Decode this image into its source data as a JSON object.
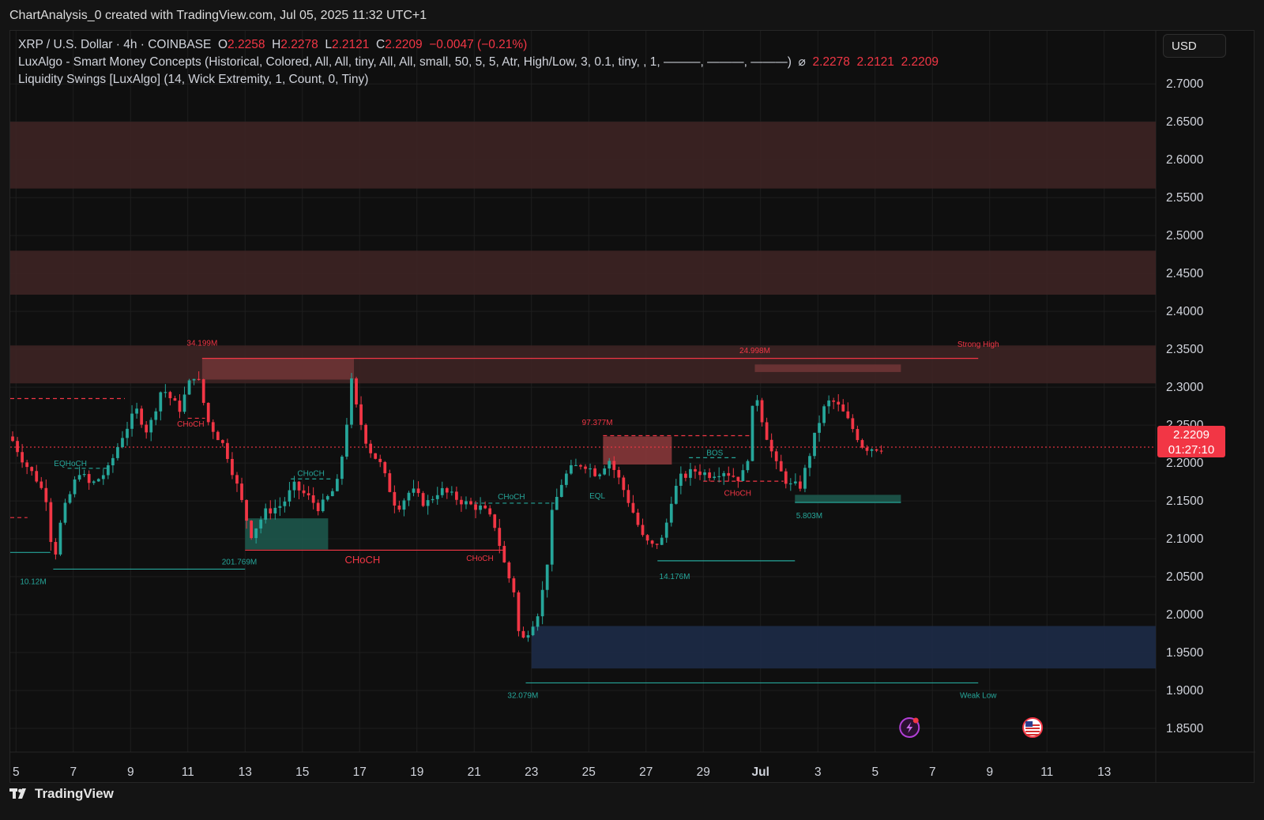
{
  "header": {
    "credit": "ChartAnalysis_0 created with TradingView.com, Jul 05, 2025 11:32 UTC+1"
  },
  "legend": {
    "line1": {
      "symbol": "XRP / U.S. Dollar · 4h · COINBASE",
      "o_label": "O",
      "o_value": "2.2258",
      "h_label": "H",
      "h_value": "2.2278",
      "l_label": "L",
      "l_value": "2.2121",
      "c_label": "C",
      "c_value": "2.2209",
      "change": "−0.0047 (−0.21%)"
    },
    "line2": {
      "text": "LuxAlgo - Smart Money Concepts (Historical, Colored, All, All, tiny, All, All, small, 50, 5, 5, Atr, High/Low, 3, 0.1, tiny, , 1, ———, ———, ———)",
      "symbol": "⌀",
      "v1": "2.2278",
      "v2": "2.2121",
      "v3": "2.2209"
    },
    "line3": {
      "text": "Liquidity Swings [LuxAlgo] (14, Wick Extremity, 1, Count, 0, Tiny)"
    }
  },
  "currency": "USD",
  "last_price": {
    "value": "2.2209",
    "countdown": "01:27:10"
  },
  "brand": {
    "name": "TradingView"
  },
  "colors": {
    "up": "#26a69a",
    "down": "#f23645",
    "background": "#0f0f0f",
    "supply_zone": "#3d2324",
    "demand_zone": "#1c2a45",
    "grid": "#1e1e1e"
  },
  "icons": [
    "lightning-event-icon",
    "us-flag-icon"
  ],
  "chart_data": {
    "type": "candlestick",
    "timeframe": "4h",
    "ylim": [
      1.825,
      2.72
    ],
    "y_ticks": [
      2.7,
      2.65,
      2.6,
      2.55,
      2.5,
      2.45,
      2.4,
      2.35,
      2.3,
      2.25,
      2.2,
      2.15,
      2.1,
      2.05,
      2.0,
      1.95,
      1.9,
      1.85
    ],
    "y_tick_labels": [
      "2.7000",
      "2.6500",
      "2.6000",
      "2.5500",
      "2.5000",
      "2.4500",
      "2.4000",
      "2.3500",
      "2.3000",
      "2.2500",
      "2.2000",
      "2.1500",
      "2.1000",
      "2.0500",
      "2.0000",
      "1.9500",
      "1.9000",
      "1.8500"
    ],
    "x_day_range": [
      4.8,
      44.8
    ],
    "x_ticks": [
      {
        "day": 5,
        "label": "5"
      },
      {
        "day": 7,
        "label": "7"
      },
      {
        "day": 9,
        "label": "9"
      },
      {
        "day": 11,
        "label": "11"
      },
      {
        "day": 13,
        "label": "13"
      },
      {
        "day": 15,
        "label": "15"
      },
      {
        "day": 17,
        "label": "17"
      },
      {
        "day": 19,
        "label": "19"
      },
      {
        "day": 21,
        "label": "21"
      },
      {
        "day": 23,
        "label": "23"
      },
      {
        "day": 25,
        "label": "25"
      },
      {
        "day": 27,
        "label": "27"
      },
      {
        "day": 29,
        "label": "29"
      },
      {
        "day": 31,
        "label": "Jul"
      },
      {
        "day": 33,
        "label": "3"
      },
      {
        "day": 35,
        "label": "5"
      },
      {
        "day": 37,
        "label": "7"
      },
      {
        "day": 39,
        "label": "9"
      },
      {
        "day": 41,
        "label": "11"
      },
      {
        "day": 43,
        "label": "13"
      }
    ],
    "anchors": [
      [
        4.8,
        2.235
      ],
      [
        5.3,
        2.2
      ],
      [
        5.7,
        2.18
      ],
      [
        6.1,
        2.15
      ],
      [
        6.3,
        2.065
      ],
      [
        6.6,
        2.13
      ],
      [
        7.2,
        2.19
      ],
      [
        7.6,
        2.17
      ],
      [
        8.2,
        2.19
      ],
      [
        8.7,
        2.235
      ],
      [
        9.2,
        2.27
      ],
      [
        9.6,
        2.24
      ],
      [
        10.1,
        2.3
      ],
      [
        10.7,
        2.27
      ],
      [
        11.1,
        2.31
      ],
      [
        11.3,
        2.32
      ],
      [
        11.7,
        2.255
      ],
      [
        12.3,
        2.22
      ],
      [
        12.8,
        2.16
      ],
      [
        13.2,
        2.105
      ],
      [
        13.7,
        2.135
      ],
      [
        14.3,
        2.145
      ],
      [
        14.7,
        2.17
      ],
      [
        15.2,
        2.155
      ],
      [
        15.6,
        2.14
      ],
      [
        16.2,
        2.17
      ],
      [
        16.5,
        2.235
      ],
      [
        16.7,
        2.31
      ],
      [
        16.9,
        2.27
      ],
      [
        17.3,
        2.22
      ],
      [
        17.7,
        2.2
      ],
      [
        18.3,
        2.14
      ],
      [
        18.8,
        2.165
      ],
      [
        19.3,
        2.145
      ],
      [
        19.8,
        2.165
      ],
      [
        20.3,
        2.155
      ],
      [
        20.8,
        2.145
      ],
      [
        21.3,
        2.14
      ],
      [
        21.7,
        2.12
      ],
      [
        22.1,
        2.06
      ],
      [
        22.4,
        2.03
      ],
      [
        22.6,
        1.96
      ],
      [
        22.9,
        1.98
      ],
      [
        23.2,
        2.0
      ],
      [
        23.5,
        2.05
      ],
      [
        23.7,
        2.13
      ],
      [
        24.0,
        2.17
      ],
      [
        24.3,
        2.19
      ],
      [
        24.8,
        2.2
      ],
      [
        25.3,
        2.185
      ],
      [
        25.7,
        2.205
      ],
      [
        26.1,
        2.175
      ],
      [
        26.5,
        2.14
      ],
      [
        26.9,
        2.1
      ],
      [
        27.2,
        2.09
      ],
      [
        27.6,
        2.1
      ],
      [
        27.9,
        2.155
      ],
      [
        28.2,
        2.18
      ],
      [
        28.7,
        2.19
      ],
      [
        29.2,
        2.185
      ],
      [
        29.7,
        2.19
      ],
      [
        30.2,
        2.18
      ],
      [
        30.5,
        2.19
      ],
      [
        30.8,
        2.3
      ],
      [
        31.1,
        2.25
      ],
      [
        31.5,
        2.2
      ],
      [
        32.0,
        2.17
      ],
      [
        32.4,
        2.17
      ],
      [
        32.7,
        2.21
      ],
      [
        33.0,
        2.25
      ],
      [
        33.3,
        2.28
      ],
      [
        33.6,
        2.28
      ],
      [
        33.9,
        2.265
      ],
      [
        34.3,
        2.24
      ],
      [
        34.6,
        2.22
      ],
      [
        35.0,
        2.22
      ],
      [
        35.3,
        2.221
      ]
    ],
    "zones": [
      {
        "type": "supply",
        "top": 2.65,
        "bottom": 2.562,
        "x_start": 4.8,
        "x_end": 44.8
      },
      {
        "type": "supply",
        "top": 2.48,
        "bottom": 2.422,
        "x_start": 4.8,
        "x_end": 44.8
      },
      {
        "type": "supply",
        "top": 2.355,
        "bottom": 2.305,
        "x_start": 4.8,
        "x_end": 44.8
      },
      {
        "type": "supply",
        "top": 2.338,
        "bottom": 2.31,
        "x_start": 11.5,
        "x_end": 16.8
      },
      {
        "type": "supply",
        "top": 2.33,
        "bottom": 2.32,
        "x_start": 30.8,
        "x_end": 35.9
      },
      {
        "type": "order_block_bear",
        "top": 2.235,
        "bottom": 2.198,
        "x_start": 25.5,
        "x_end": 27.9
      },
      {
        "type": "order_block_bull",
        "top": 2.127,
        "bottom": 2.086,
        "x_start": 13.0,
        "x_end": 15.9
      },
      {
        "type": "order_block_bull",
        "top": 2.158,
        "bottom": 2.148,
        "x_start": 32.2,
        "x_end": 35.9
      },
      {
        "type": "demand",
        "top": 1.985,
        "bottom": 1.929,
        "x_start": 23.0,
        "x_end": 44.8
      }
    ],
    "lines": [
      {
        "color": "red",
        "style": "solid",
        "y": 2.338,
        "x1": 11.5,
        "x2": 38.6
      },
      {
        "color": "red",
        "style": "solid",
        "y": 2.085,
        "x1": 13.0,
        "x2": 22.0
      },
      {
        "color": "red",
        "style": "dashed",
        "y": 2.285,
        "x1": 4.8,
        "x2": 8.8
      },
      {
        "color": "red",
        "style": "dashed",
        "y": 2.259,
        "x1": 11.0,
        "x2": 11.6
      },
      {
        "color": "red",
        "style": "dashed",
        "y": 2.236,
        "x1": 25.5,
        "x2": 30.7
      },
      {
        "color": "red",
        "style": "dashed",
        "y": 2.176,
        "x1": 29.0,
        "x2": 31.8
      },
      {
        "color": "red",
        "style": "dashed",
        "y": 2.128,
        "x1": 4.8,
        "x2": 5.4
      },
      {
        "color": "red",
        "style": "dotted",
        "y": 2.2209,
        "x1": 4.8,
        "x2": 44.8
      },
      {
        "color": "green",
        "style": "solid",
        "y": 2.06,
        "x1": 6.3,
        "x2": 13.0
      },
      {
        "color": "green",
        "style": "solid",
        "y": 2.082,
        "x1": 4.8,
        "x2": 6.2
      },
      {
        "color": "green",
        "style": "solid",
        "y": 2.071,
        "x1": 27.4,
        "x2": 32.2
      },
      {
        "color": "green",
        "style": "solid",
        "y": 1.91,
        "x1": 22.8,
        "x2": 38.6
      },
      {
        "color": "green",
        "style": "solid",
        "y": 2.148,
        "x1": 32.2,
        "x2": 35.9
      },
      {
        "color": "green",
        "style": "dashed",
        "y": 2.193,
        "x1": 6.8,
        "x2": 8.2
      },
      {
        "color": "green",
        "style": "dashed",
        "y": 2.179,
        "x1": 14.6,
        "x2": 16.0
      },
      {
        "color": "green",
        "style": "dashed",
        "y": 2.147,
        "x1": 21.0,
        "x2": 23.8
      },
      {
        "color": "green",
        "style": "dashed",
        "y": 2.207,
        "x1": 28.5,
        "x2": 30.2
      }
    ],
    "labels": [
      {
        "text": "34.199M",
        "day": 11.5,
        "y": 2.355,
        "color": "red",
        "size": 10
      },
      {
        "text": "24.998M",
        "day": 30.8,
        "y": 2.345,
        "color": "red",
        "size": 10
      },
      {
        "text": "Strong High",
        "day": 38.6,
        "y": 2.353,
        "color": "red",
        "size": 10
      },
      {
        "text": "97.377M",
        "day": 25.3,
        "y": 2.25,
        "color": "red",
        "size": 10
      },
      {
        "text": "CHoCH",
        "day": 11.1,
        "y": 2.248,
        "color": "red",
        "size": 10
      },
      {
        "text": "CHoCH",
        "day": 17.1,
        "y": 2.068,
        "color": "red",
        "size": 13
      },
      {
        "text": "CHoCH",
        "day": 21.2,
        "y": 2.071,
        "color": "red",
        "size": 10
      },
      {
        "text": "CHoCH",
        "day": 30.2,
        "y": 2.157,
        "color": "red",
        "size": 10
      },
      {
        "text": "EQHoCH",
        "day": 6.9,
        "y": 2.196,
        "color": "green",
        "size": 10
      },
      {
        "text": "CHoCH",
        "day": 15.3,
        "y": 2.183,
        "color": "green",
        "size": 10
      },
      {
        "text": "CHoCH",
        "day": 22.3,
        "y": 2.152,
        "color": "green",
        "size": 10
      },
      {
        "text": "EQL",
        "day": 25.3,
        "y": 2.153,
        "color": "green",
        "size": 10
      },
      {
        "text": "BOS",
        "day": 29.4,
        "y": 2.21,
        "color": "green",
        "size": 10
      },
      {
        "text": "10.12M",
        "day": 5.6,
        "y": 2.04,
        "color": "green",
        "size": 10
      },
      {
        "text": "201.769M",
        "day": 12.8,
        "y": 2.066,
        "color": "green",
        "size": 10
      },
      {
        "text": "14.176M",
        "day": 28.0,
        "y": 2.047,
        "color": "green",
        "size": 10
      },
      {
        "text": "5.803M",
        "day": 32.7,
        "y": 2.127,
        "color": "green",
        "size": 10
      },
      {
        "text": "32.079M",
        "day": 22.7,
        "y": 1.89,
        "color": "green",
        "size": 10
      },
      {
        "text": "Weak Low",
        "day": 38.6,
        "y": 1.89,
        "color": "green",
        "size": 10
      }
    ]
  }
}
